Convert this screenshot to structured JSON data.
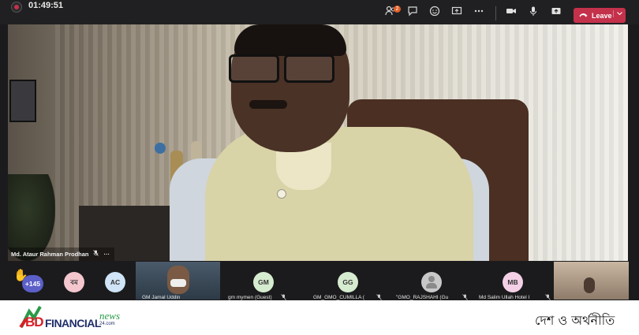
{
  "meeting": {
    "elapsed_time": "01:49:51",
    "participants_badge": "2",
    "leave_label": "Leave",
    "colors": {
      "leave": "#c4314b",
      "badge": "#e35d25",
      "overflow_badge": "#5b5fc7"
    }
  },
  "toolbar": {
    "icons": [
      "participants-icon",
      "chat-icon",
      "reactions-icon",
      "share-screen-icon",
      "more-actions-icon",
      "camera-icon",
      "microphone-icon",
      "share-tray-icon"
    ]
  },
  "main_video": {
    "speaker_name": "Md. Ataur Rahman Prodhan",
    "more": "···"
  },
  "participant_strip": {
    "raised_hand": "✋",
    "overflow_count": "+145",
    "tiles": [
      {
        "initials": "বম",
        "label": "",
        "color": "#f4c7cf"
      },
      {
        "initials": "AC",
        "label": "",
        "color": "#cfe4f6"
      },
      {
        "initials": "",
        "label": "GM Jamal Uddin"
      },
      {
        "initials": "GM",
        "label": "gm mymen (Guest)",
        "color": "#d6ecd0"
      },
      {
        "initials": "GG",
        "label": "GM_GMO_CUMILLA (",
        "color": "#d6ecd0"
      },
      {
        "initials": "",
        "label": "\"GMO_RAJSHAHI (Gu"
      },
      {
        "initials": "MB",
        "label": "Md Salim Ullah Hotel I",
        "color": "#f4d0e6"
      },
      {
        "initials": "",
        "label": ""
      }
    ]
  },
  "footer": {
    "logo_bd": "BD",
    "logo_financial": "FINANCIAL",
    "logo_news": "news",
    "logo_24": "24.com",
    "tagline": "দেশ ও অর্থনীতি"
  }
}
